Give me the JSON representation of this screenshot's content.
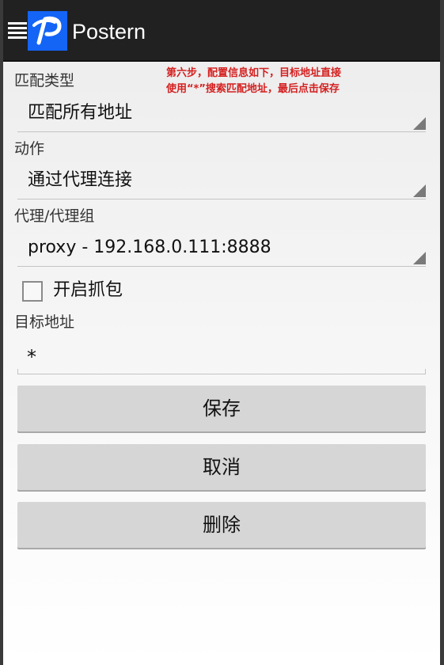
{
  "app": {
    "title": "Postern",
    "logo_icon": "postern-logo-icon",
    "brand_color": "#1464f6",
    "toolbar_color": "#212121"
  },
  "annotation": {
    "line1": "第六步，配置信息如下，目标地址直接",
    "line2": "使用“*”搜索匹配地址，最后点击保存",
    "color": "#d42020"
  },
  "form": {
    "match_type": {
      "label": "匹配类型",
      "value": "匹配所有地址"
    },
    "action": {
      "label": "动作",
      "value": "通过代理连接"
    },
    "proxy": {
      "label": "代理/代理组",
      "value": "proxy - 192.168.0.111:8888"
    },
    "capture": {
      "label": "开启抓包",
      "checked": false
    },
    "target": {
      "label": "目标地址",
      "value": "*"
    }
  },
  "buttons": {
    "save": "保存",
    "cancel": "取消",
    "delete": "删除"
  }
}
